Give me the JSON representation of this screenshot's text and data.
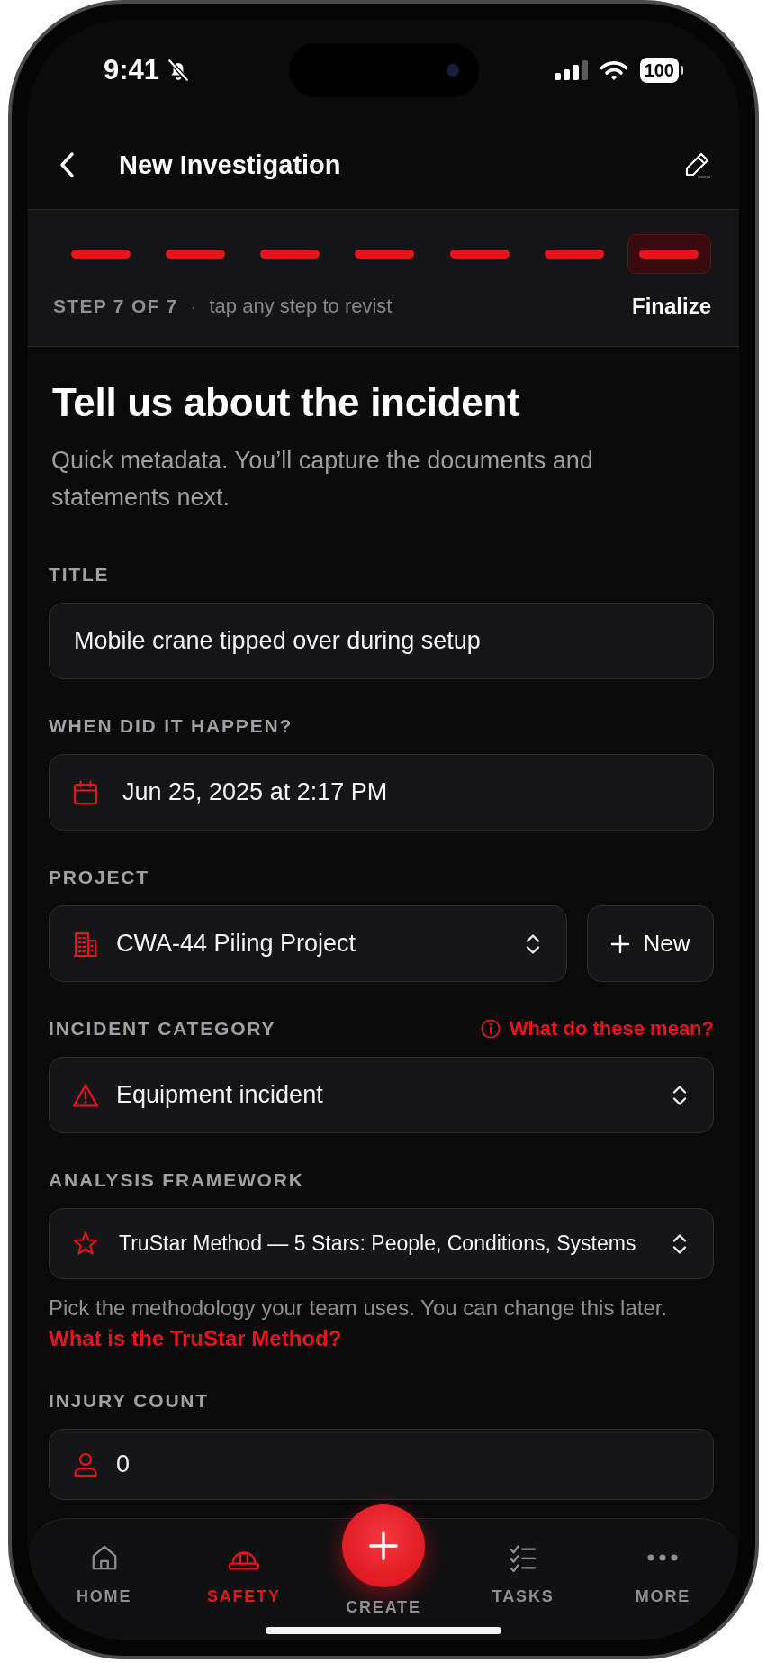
{
  "status_bar": {
    "time": "9:41",
    "battery": "100"
  },
  "header": {
    "title": "New Investigation"
  },
  "progress": {
    "steps": [
      {
        "selected": false
      },
      {
        "selected": false
      },
      {
        "selected": false
      },
      {
        "selected": false
      },
      {
        "selected": false
      },
      {
        "selected": false
      },
      {
        "selected": true
      }
    ],
    "step_label": "STEP 7 OF 7",
    "separator": "·",
    "hint": "tap any step to revist",
    "current_step": "Finalize"
  },
  "form": {
    "heading": "Tell us about the incident",
    "subtitle": "Quick metadata. You’ll capture the documents and statements next.",
    "fields": [
      {
        "kind": "text",
        "label": "TITLE",
        "value": "Mobile crane tipped over during setup"
      },
      {
        "kind": "date",
        "label": "WHEN DID IT HAPPEN?",
        "value": "Jun 25, 2025 at 2:17 PM"
      },
      {
        "kind": "project",
        "label": "PROJECT",
        "value": "CWA-44 Piling Project",
        "action": "New"
      },
      {
        "kind": "category",
        "label": "INCIDENT CATEGORY",
        "help_link": "What do these mean?",
        "value": "Equipment incident"
      },
      {
        "kind": "framework",
        "label": "ANALYSIS FRAMEWORK",
        "value": "TruStar Method — 5 Stars: People, Conditions, Systems",
        "helper": "Pick the methodology your team uses. You can change this later.",
        "link": "What is the TruStar Method?"
      },
      {
        "kind": "count",
        "label": "INJURY COUNT",
        "value": "0"
      }
    ]
  },
  "nav": {
    "items": [
      {
        "kind": "home",
        "label": "HOME",
        "selected": false
      },
      {
        "kind": "safety",
        "label": "SAFETY",
        "selected": true
      },
      {
        "kind": "create",
        "label": "CREATE",
        "selected": false
      },
      {
        "kind": "tasks",
        "label": "TASKS",
        "selected": false
      },
      {
        "kind": "more",
        "label": "MORE",
        "selected": false
      }
    ]
  }
}
